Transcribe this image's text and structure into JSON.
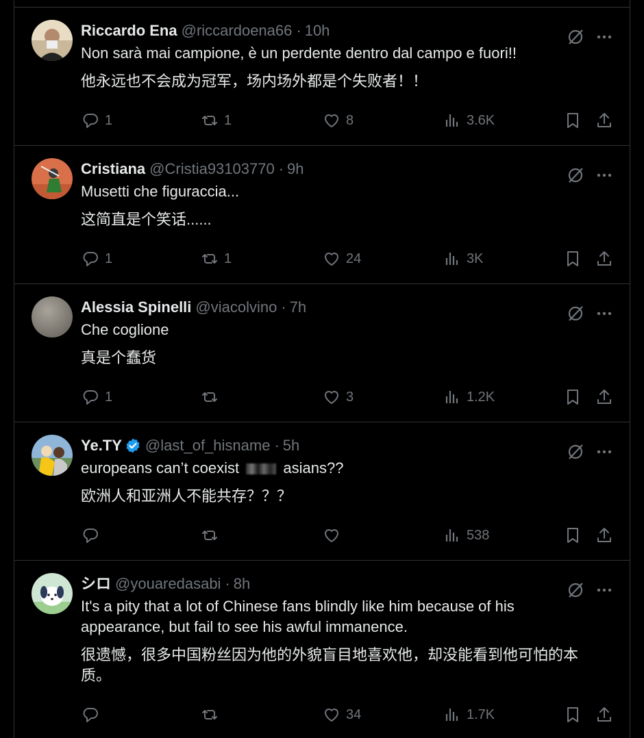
{
  "tweets": [
    {
      "name": "Riccardo Ena",
      "handle": "@riccardoena66",
      "time": "10h",
      "text": "Non sarà mai campione, è un perdente dentro dal campo e fuori!!",
      "translation": "他永远也不会成为冠军，场内场外都是个失败者！！",
      "replies": "1",
      "reposts": "1",
      "likes": "8",
      "views": "3.6K"
    },
    {
      "name": "Cristiana",
      "handle": "@Cristia93103770",
      "time": "9h",
      "text": "Musetti che figuraccia...",
      "translation": "这简直是个笑话......",
      "replies": "1",
      "reposts": "1",
      "likes": "24",
      "views": "3K"
    },
    {
      "name": "Alessia Spinelli",
      "handle": "@viacolvino",
      "time": "7h",
      "text": "Che coglione",
      "translation": "真是个蠢货",
      "replies": "1",
      "reposts": "",
      "likes": "3",
      "views": "1.2K"
    },
    {
      "name": "Ye.TY",
      "handle": "@last_of_hisname",
      "time": "5h",
      "verified": true,
      "text_before": "europeans can’t coexist",
      "text_after": "asians??",
      "translation": "欧洲人和亚洲人不能共存？？？",
      "replies": "",
      "reposts": "",
      "likes": "",
      "views": "538"
    },
    {
      "name": "シロ",
      "handle": "@youaredasabi",
      "time": "8h",
      "text": "It's a pity that a lot of Chinese fans blindly like him because of his appearance, but fail to see his awful immanence.",
      "translation": "很遗憾，很多中国粉丝因为他的外貌盲目地喜欢他，却没能看到他可怕的本质。",
      "replies": "",
      "reposts": "",
      "likes": "34",
      "views": "1.7K"
    }
  ],
  "colors": {
    "background": "#000000",
    "primary_text": "#e7e9ea",
    "secondary_text": "#71767b",
    "border": "#2f3336",
    "verified": "#1d9bf0"
  },
  "icons": [
    "reply-icon",
    "repost-icon",
    "like-icon",
    "views-icon",
    "bookmark-icon",
    "share-icon",
    "grok-icon",
    "more-icon",
    "verified-icon"
  ]
}
